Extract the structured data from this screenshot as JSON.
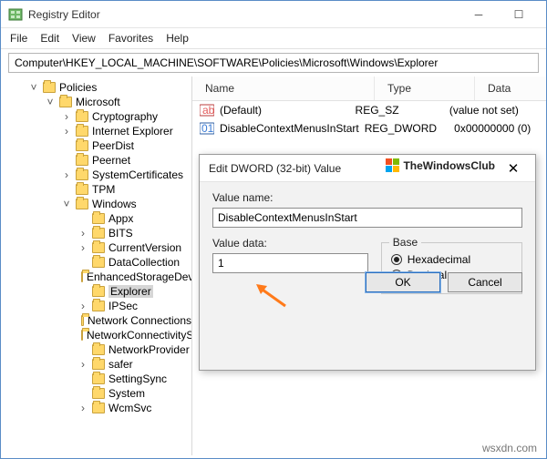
{
  "window": {
    "title": "Registry Editor",
    "sys": {
      "min": "─",
      "max": "☐",
      "close": "✕"
    }
  },
  "menu": {
    "file": "File",
    "edit": "Edit",
    "view": "View",
    "favorites": "Favorites",
    "help": "Help"
  },
  "address": "Computer\\HKEY_LOCAL_MACHINE\\SOFTWARE\\Policies\\Microsoft\\Windows\\Explorer",
  "columns": {
    "name": "Name",
    "type": "Type",
    "data": "Data"
  },
  "values": [
    {
      "icon": "ab",
      "name": "(Default)",
      "type": "REG_SZ",
      "data": "(value not set)"
    },
    {
      "icon": "dw",
      "name": "DisableContextMenusInStart",
      "type": "REG_DWORD",
      "data": "0x00000000 (0)"
    }
  ],
  "tree": {
    "root": "Policies",
    "microsoft": "Microsoft",
    "children_ms": [
      "Cryptography",
      "Internet Explorer",
      "PeerDist",
      "Peernet",
      "SystemCertificates",
      "TPM"
    ],
    "windows": "Windows",
    "children_win": [
      "Appx",
      "BITS",
      "CurrentVersion",
      "DataCollection",
      "EnhancedStorageDevices",
      "Explorer",
      "IPSec",
      "Network Connections",
      "NetworkConnectivityStatusIndicator",
      "NetworkProvider",
      "safer",
      "SettingSync",
      "System",
      "WcmSvc"
    ]
  },
  "dialog": {
    "title": "Edit DWORD (32-bit) Value",
    "value_name_label": "Value name:",
    "value_name": "DisableContextMenusInStart",
    "value_data_label": "Value data:",
    "value_data": "1",
    "base_label": "Base",
    "hex": "Hexadecimal",
    "dec": "Decimal",
    "ok": "OK",
    "cancel": "Cancel"
  },
  "brand": "TheWindowsClub",
  "caption": "wsxdn.com"
}
